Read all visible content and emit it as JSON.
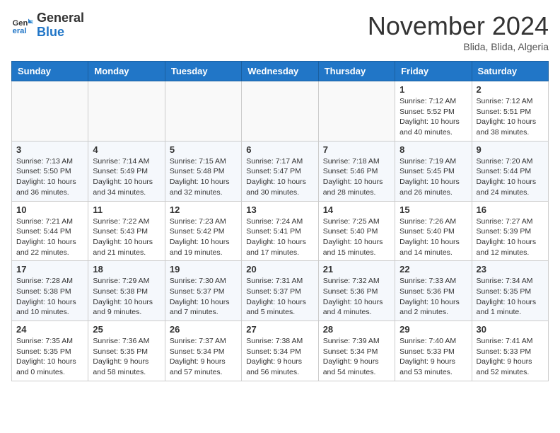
{
  "header": {
    "logo_general": "General",
    "logo_blue": "Blue",
    "month_title": "November 2024",
    "location": "Blida, Blida, Algeria"
  },
  "weekdays": [
    "Sunday",
    "Monday",
    "Tuesday",
    "Wednesday",
    "Thursday",
    "Friday",
    "Saturday"
  ],
  "weeks": [
    [
      {
        "day": "",
        "info": ""
      },
      {
        "day": "",
        "info": ""
      },
      {
        "day": "",
        "info": ""
      },
      {
        "day": "",
        "info": ""
      },
      {
        "day": "",
        "info": ""
      },
      {
        "day": "1",
        "info": "Sunrise: 7:12 AM\nSunset: 5:52 PM\nDaylight: 10 hours and 40 minutes."
      },
      {
        "day": "2",
        "info": "Sunrise: 7:12 AM\nSunset: 5:51 PM\nDaylight: 10 hours and 38 minutes."
      }
    ],
    [
      {
        "day": "3",
        "info": "Sunrise: 7:13 AM\nSunset: 5:50 PM\nDaylight: 10 hours and 36 minutes."
      },
      {
        "day": "4",
        "info": "Sunrise: 7:14 AM\nSunset: 5:49 PM\nDaylight: 10 hours and 34 minutes."
      },
      {
        "day": "5",
        "info": "Sunrise: 7:15 AM\nSunset: 5:48 PM\nDaylight: 10 hours and 32 minutes."
      },
      {
        "day": "6",
        "info": "Sunrise: 7:17 AM\nSunset: 5:47 PM\nDaylight: 10 hours and 30 minutes."
      },
      {
        "day": "7",
        "info": "Sunrise: 7:18 AM\nSunset: 5:46 PM\nDaylight: 10 hours and 28 minutes."
      },
      {
        "day": "8",
        "info": "Sunrise: 7:19 AM\nSunset: 5:45 PM\nDaylight: 10 hours and 26 minutes."
      },
      {
        "day": "9",
        "info": "Sunrise: 7:20 AM\nSunset: 5:44 PM\nDaylight: 10 hours and 24 minutes."
      }
    ],
    [
      {
        "day": "10",
        "info": "Sunrise: 7:21 AM\nSunset: 5:44 PM\nDaylight: 10 hours and 22 minutes."
      },
      {
        "day": "11",
        "info": "Sunrise: 7:22 AM\nSunset: 5:43 PM\nDaylight: 10 hours and 21 minutes."
      },
      {
        "day": "12",
        "info": "Sunrise: 7:23 AM\nSunset: 5:42 PM\nDaylight: 10 hours and 19 minutes."
      },
      {
        "day": "13",
        "info": "Sunrise: 7:24 AM\nSunset: 5:41 PM\nDaylight: 10 hours and 17 minutes."
      },
      {
        "day": "14",
        "info": "Sunrise: 7:25 AM\nSunset: 5:40 PM\nDaylight: 10 hours and 15 minutes."
      },
      {
        "day": "15",
        "info": "Sunrise: 7:26 AM\nSunset: 5:40 PM\nDaylight: 10 hours and 14 minutes."
      },
      {
        "day": "16",
        "info": "Sunrise: 7:27 AM\nSunset: 5:39 PM\nDaylight: 10 hours and 12 minutes."
      }
    ],
    [
      {
        "day": "17",
        "info": "Sunrise: 7:28 AM\nSunset: 5:38 PM\nDaylight: 10 hours and 10 minutes."
      },
      {
        "day": "18",
        "info": "Sunrise: 7:29 AM\nSunset: 5:38 PM\nDaylight: 10 hours and 9 minutes."
      },
      {
        "day": "19",
        "info": "Sunrise: 7:30 AM\nSunset: 5:37 PM\nDaylight: 10 hours and 7 minutes."
      },
      {
        "day": "20",
        "info": "Sunrise: 7:31 AM\nSunset: 5:37 PM\nDaylight: 10 hours and 5 minutes."
      },
      {
        "day": "21",
        "info": "Sunrise: 7:32 AM\nSunset: 5:36 PM\nDaylight: 10 hours and 4 minutes."
      },
      {
        "day": "22",
        "info": "Sunrise: 7:33 AM\nSunset: 5:36 PM\nDaylight: 10 hours and 2 minutes."
      },
      {
        "day": "23",
        "info": "Sunrise: 7:34 AM\nSunset: 5:35 PM\nDaylight: 10 hours and 1 minute."
      }
    ],
    [
      {
        "day": "24",
        "info": "Sunrise: 7:35 AM\nSunset: 5:35 PM\nDaylight: 10 hours and 0 minutes."
      },
      {
        "day": "25",
        "info": "Sunrise: 7:36 AM\nSunset: 5:35 PM\nDaylight: 9 hours and 58 minutes."
      },
      {
        "day": "26",
        "info": "Sunrise: 7:37 AM\nSunset: 5:34 PM\nDaylight: 9 hours and 57 minutes."
      },
      {
        "day": "27",
        "info": "Sunrise: 7:38 AM\nSunset: 5:34 PM\nDaylight: 9 hours and 56 minutes."
      },
      {
        "day": "28",
        "info": "Sunrise: 7:39 AM\nSunset: 5:34 PM\nDaylight: 9 hours and 54 minutes."
      },
      {
        "day": "29",
        "info": "Sunrise: 7:40 AM\nSunset: 5:33 PM\nDaylight: 9 hours and 53 minutes."
      },
      {
        "day": "30",
        "info": "Sunrise: 7:41 AM\nSunset: 5:33 PM\nDaylight: 9 hours and 52 minutes."
      }
    ]
  ]
}
